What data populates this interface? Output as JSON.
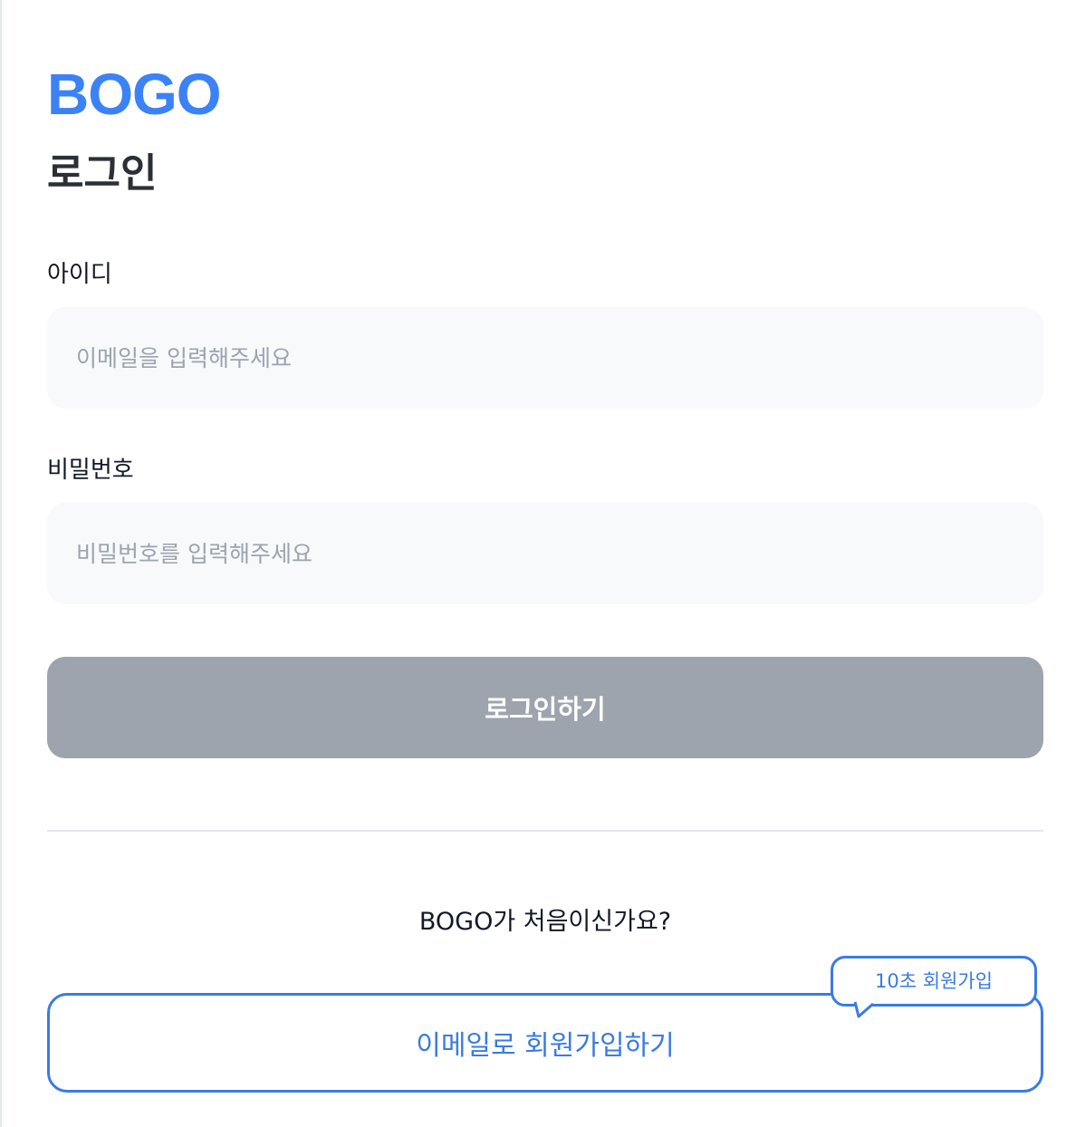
{
  "brand": {
    "logo_text": "BOGO",
    "accent_color": "#3b82f6"
  },
  "page": {
    "title": "로그인"
  },
  "form": {
    "id_label": "아이디",
    "id_placeholder": "이메일을 입력해주세요",
    "id_value": "",
    "password_label": "비밀번호",
    "password_placeholder": "비밀번호를 입력해주세요",
    "password_value": "",
    "login_button_label": "로그인하기",
    "login_button_color": "#9ea4ae"
  },
  "signup": {
    "prompt": "BOGO가 처음이신가요?",
    "button_label": "이메일로 회원가입하기",
    "tooltip": "10초 회원가입",
    "border_color": "#3b7be3"
  }
}
